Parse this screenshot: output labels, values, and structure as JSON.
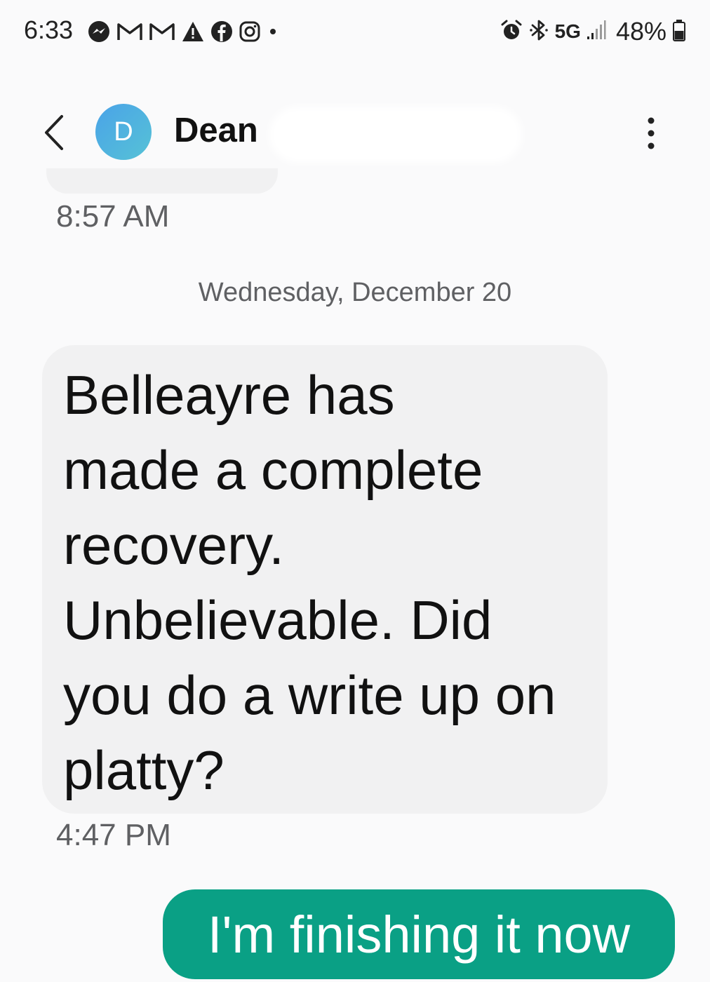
{
  "status_bar": {
    "time": "6:33",
    "notification_icons": [
      "messenger-icon",
      "gmail-icon",
      "gmail-icon",
      "warning-icon",
      "facebook-icon",
      "instagram-icon",
      "dot-icon"
    ],
    "network": "5G",
    "battery": "48%",
    "right_icons": [
      "alarm-icon",
      "bluetooth-icon",
      "signal-icon",
      "battery-icon"
    ]
  },
  "header": {
    "avatar_initial": "D",
    "contact_name": "Dean",
    "back_icon": "chevron-left-icon",
    "more_icon": "more-vertical-icon"
  },
  "conversation": {
    "previous_timestamp": "8:57 AM",
    "date_separator": "Wednesday, December 20",
    "messages": [
      {
        "direction": "incoming",
        "text": "Belleayre has\nmade a complete\nrecovery.\nUnbelievable. Did\nyou do a write up on\nplatty?",
        "time": "4:47 PM"
      },
      {
        "direction": "outgoing",
        "text": "I'm finishing it now"
      }
    ]
  },
  "colors": {
    "background": "#fafafb",
    "incoming_bubble": "#f1f1f2",
    "outgoing_bubble": "#0aa085",
    "avatar": "#4aa3e8"
  }
}
